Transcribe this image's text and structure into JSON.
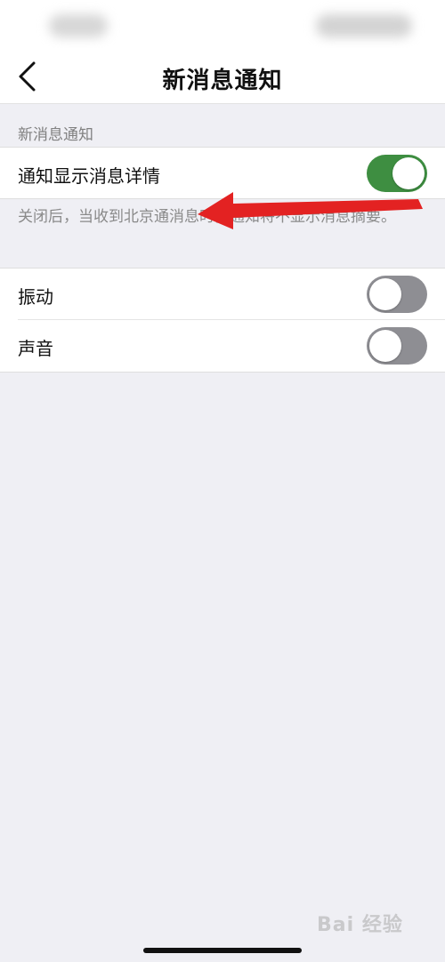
{
  "nav": {
    "title": "新消息通知",
    "back_icon": "chevron-left-icon"
  },
  "section_header": "新消息通知",
  "notification_detail": {
    "label": "通知显示消息详情",
    "enabled": true,
    "description": "关闭后，当收到北京通消息时，通知将不显示消息摘要。"
  },
  "settings": [
    {
      "label": "振动",
      "enabled": false
    },
    {
      "label": "声音",
      "enabled": false
    }
  ],
  "colors": {
    "toggle_on": "#3e8e41",
    "toggle_off": "#8e8e93",
    "annotation_arrow": "#e32222",
    "background": "#efeff4"
  },
  "watermark": "Bai 经验"
}
